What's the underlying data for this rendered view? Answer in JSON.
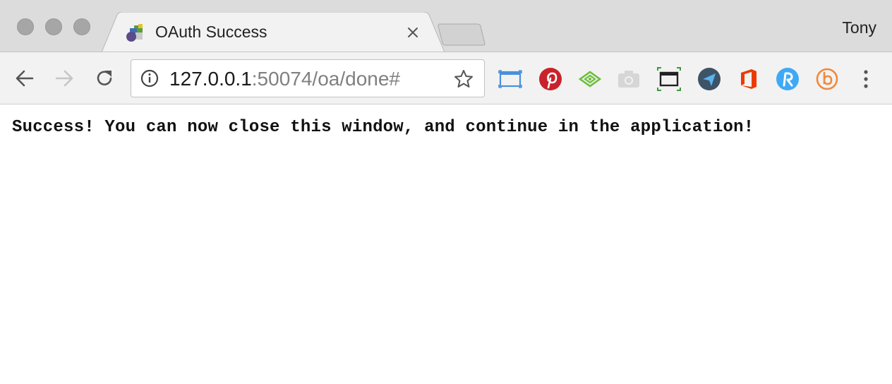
{
  "window": {
    "profile_name": "Tony"
  },
  "tab": {
    "title": "OAuth Success",
    "favicon": "cube-stack-icon"
  },
  "toolbar": {
    "url_host": "127.0.0.1",
    "url_rest": ":50074/oa/done#",
    "extensions": [
      "screen-capture-icon",
      "pinterest-icon",
      "feedly-eye-icon",
      "camera-icon",
      "screenshot-frame-icon",
      "send-arrow-icon",
      "office-icon",
      "r-refresh-icon",
      "b-circle-icon"
    ]
  },
  "page": {
    "message": "Success! You can now close this window, and continue in the application!"
  },
  "colors": {
    "tabstrip": "#dcdcdc",
    "toolbar": "#f2f2f2",
    "pinterest": "#c8232c",
    "office": "#eb3c00",
    "accent_blue": "#4a90d9"
  }
}
